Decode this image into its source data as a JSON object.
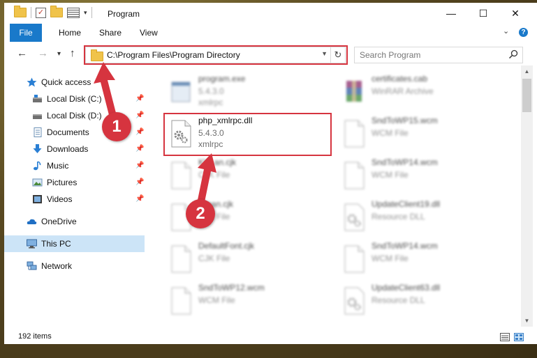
{
  "window": {
    "title": "Program",
    "controls": {
      "minimize": "—",
      "maximize": "☐",
      "close": "✕"
    }
  },
  "ribbon": {
    "tabs": [
      "File",
      "Home",
      "Share",
      "View"
    ],
    "help": "?"
  },
  "address": {
    "path": "C:\\Program Files\\Program Directory",
    "refresh": "↻",
    "search_placeholder": "Search Program"
  },
  "nav": {
    "back": "←",
    "forward": "→",
    "recent": "▾",
    "up": "↑"
  },
  "sidebar": {
    "items": [
      {
        "label": "Quick access",
        "icon": "star-icon"
      },
      {
        "label": "Local Disk (C:)",
        "icon": "drive-icon",
        "pinned": true
      },
      {
        "label": "Local Disk (D:)",
        "icon": "drive-icon",
        "pinned": true
      },
      {
        "label": "Documents",
        "icon": "documents-icon",
        "pinned": true
      },
      {
        "label": "Downloads",
        "icon": "downloads-icon",
        "pinned": true
      },
      {
        "label": "Music",
        "icon": "music-icon",
        "pinned": true
      },
      {
        "label": "Pictures",
        "icon": "pictures-icon",
        "pinned": true
      },
      {
        "label": "Videos",
        "icon": "videos-icon",
        "pinned": true
      },
      {
        "label": "OneDrive",
        "icon": "cloud-icon"
      },
      {
        "label": "This PC",
        "icon": "computer-icon",
        "selected": true
      },
      {
        "label": "Network",
        "icon": "network-icon"
      }
    ]
  },
  "files": [
    {
      "name": "program.exe",
      "line2": "5.4.3.0",
      "line3": "xmlrpc",
      "icon": "exe-icon",
      "blurred": true
    },
    {
      "name": "certificates.cab",
      "line2": "WinRAR Archive",
      "line3": "",
      "icon": "winrar-icon",
      "blurred": true
    },
    {
      "name": "php_xmlrpc.dll",
      "line2": "5.4.3.0",
      "line3": "xmlrpc",
      "icon": "dll-gear-icon",
      "blurred": false
    },
    {
      "name": "SndToWP15.wcm",
      "line2": "WCM File",
      "line3": "",
      "icon": "blank-file-icon",
      "blurred": true
    },
    {
      "name": "Kl…an.cjk",
      "line2": "CJK File",
      "line3": "",
      "icon": "blank-file-icon",
      "blurred": true
    },
    {
      "name": "SndToWP14.wcm",
      "line2": "WCM File",
      "line3": "",
      "icon": "blank-file-icon",
      "blurred": true
    },
    {
      "name": "…ean.cjk",
      "line2": "CJK File",
      "line3": "",
      "icon": "blank-file-icon",
      "blurred": true
    },
    {
      "name": "UpdateClient19.dll",
      "line2": "Resource DLL",
      "line3": "",
      "icon": "dll-gear-icon",
      "blurred": true
    },
    {
      "name": "DefaultFont.cjk",
      "line2": "CJK File",
      "line3": "",
      "icon": "blank-file-icon",
      "blurred": true
    },
    {
      "name": "SndToWP14.wcm",
      "line2": "WCM File",
      "line3": "",
      "icon": "blank-file-icon",
      "blurred": true
    },
    {
      "name": "SndToWP12.wcm",
      "line2": "WCM File",
      "line3": "",
      "icon": "blank-file-icon",
      "blurred": true
    },
    {
      "name": "UpdateClient63.dll",
      "line2": "Resource DLL",
      "line3": "",
      "icon": "dll-gear-icon",
      "blurred": true
    }
  ],
  "status": {
    "count": "192 items"
  },
  "annotations": {
    "step1": "1",
    "step2": "2",
    "color": "#d6343f"
  },
  "colors": {
    "accent": "#1979ca",
    "selected": "#cce4f7"
  }
}
